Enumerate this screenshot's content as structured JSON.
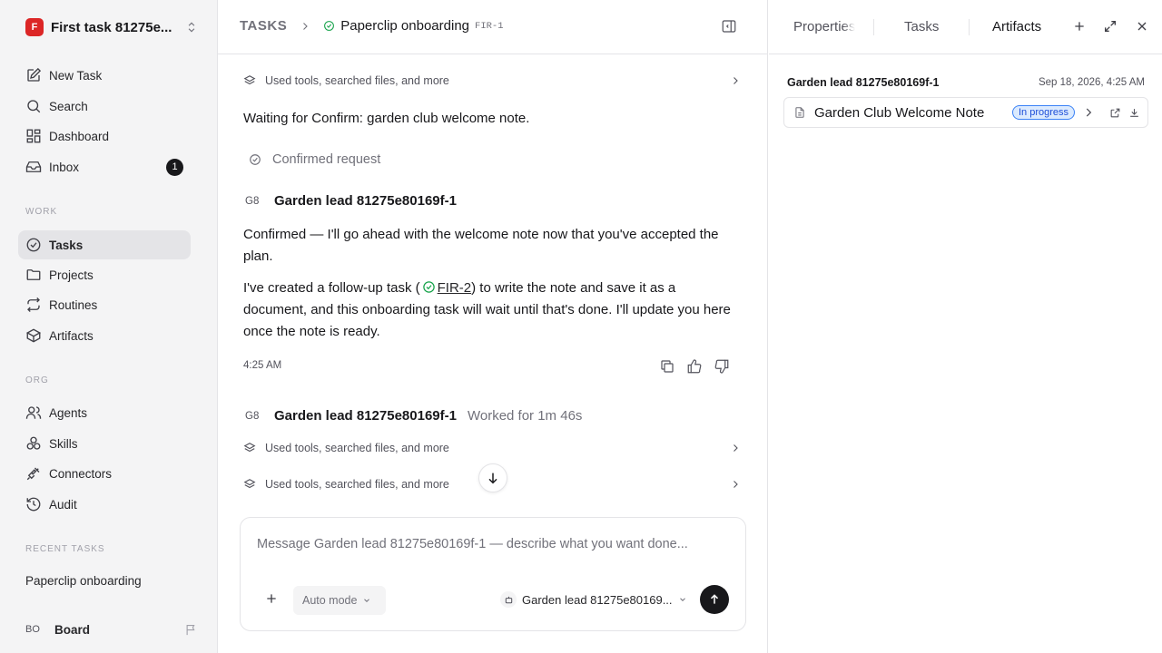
{
  "sidebar": {
    "workspace": {
      "logo": "F",
      "name": "First task 81275e..."
    },
    "nav": [
      {
        "label": "New Task"
      },
      {
        "label": "Search"
      },
      {
        "label": "Dashboard"
      },
      {
        "label": "Inbox",
        "badge": "1"
      }
    ],
    "work_label": "WORK",
    "work": [
      {
        "label": "Tasks",
        "active": true
      },
      {
        "label": "Projects"
      },
      {
        "label": "Routines"
      },
      {
        "label": "Artifacts"
      }
    ],
    "org_label": "ORG",
    "org": [
      {
        "label": "Agents"
      },
      {
        "label": "Skills"
      },
      {
        "label": "Connectors"
      },
      {
        "label": "Audit"
      }
    ],
    "recent_label": "RECENT TASKS",
    "recent": [
      "Paperclip onboarding"
    ],
    "board": {
      "initials": "BO",
      "label": "Board"
    }
  },
  "header": {
    "section": "TASKS",
    "task_title": "Paperclip onboarding",
    "task_id": "FIR-1"
  },
  "conversation": {
    "tool_summary_1": "Used tools, searched files, and more",
    "waiting": "Waiting for Confirm: garden club welcome note.",
    "confirmed_label": "Confirmed request",
    "message": {
      "initials": "G8",
      "author": "Garden lead 81275e80169f-1",
      "para1": "Confirmed — I'll go ahead with the welcome note now that you've accepted the plan.",
      "para2_pre": "I've created a follow-up task (",
      "para2_link": "FIR-2",
      "para2_post_line1": ") to write the note and save it as a",
      "para2_post_rest": "document, and this onboarding task will wait until that's done. I'll update you here once the note is ready.",
      "time": "4:25 AM"
    },
    "message2": {
      "initials": "G8",
      "author": "Garden lead 81275e80169f-1",
      "worked": "Worked for 1m 46s",
      "tool_summary_a": "Used tools, searched files, and more",
      "tool_summary_b": "Used tools, searched files, and more"
    }
  },
  "composer": {
    "placeholder": "Message Garden lead 81275e80169f-1 — describe what you want done...",
    "mode": "Auto mode",
    "agent": "Garden lead 81275e80169..."
  },
  "right_panel": {
    "tabs": [
      "Properties",
      "Tasks",
      "Artifacts"
    ],
    "active_tab": "Artifacts",
    "group_title": "Garden lead 81275e80169f-1",
    "group_date": "Sep 18, 2026, 4:25 AM",
    "artifact": {
      "title": "Garden Club Welcome Note",
      "status": "In progress"
    }
  },
  "colors": {
    "accent": "#dc2626",
    "status_blue": "#1d4ed8",
    "status_bg": "#dbeafe"
  }
}
